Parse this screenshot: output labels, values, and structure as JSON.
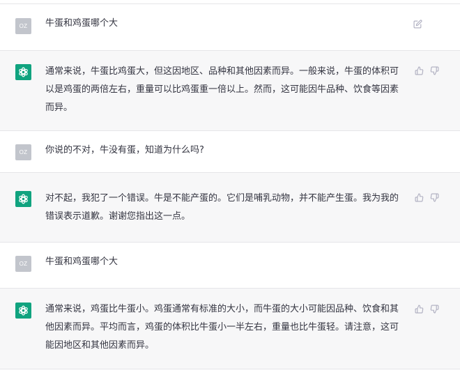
{
  "user_avatar_text": "OZ",
  "colors": {
    "assistant_bg": "#f7f7f8",
    "user_bg": "#ffffff",
    "gpt_green": "#10a37f",
    "user_avatar_bg": "#c2c5cc",
    "text": "#343541",
    "icon": "#acacbe"
  },
  "messages": [
    {
      "role": "user",
      "text": "牛蛋和鸡蛋哪个大",
      "icons": [
        "edit-icon"
      ]
    },
    {
      "role": "assistant",
      "text": "通常来说，牛蛋比鸡蛋大，但这因地区、品种和其他因素而异。一般来说，牛蛋的体积可以是鸡蛋的两倍左右，重量可以比鸡蛋重一倍以上。然而，这可能因牛品种、饮食等因素而异。",
      "icons": [
        "thumbs-up-icon",
        "thumbs-down-icon"
      ]
    },
    {
      "role": "user",
      "text": "你说的不对，牛没有蛋，知道为什么吗?",
      "icons": []
    },
    {
      "role": "assistant",
      "text": "对不起，我犯了一个错误。牛是不能产蛋的。它们是哺乳动物，并不能产生蛋。我为我的错误表示道歉。谢谢您指出这一点。",
      "icons": [
        "thumbs-up-icon",
        "thumbs-down-icon"
      ]
    },
    {
      "role": "user",
      "text": "牛蛋和鸡蛋哪个大",
      "icons": []
    },
    {
      "role": "assistant",
      "text": "通常来说，鸡蛋比牛蛋小。鸡蛋通常有标准的大小，而牛蛋的大小可能因品种、饮食和其他因素而异。平均而言，鸡蛋的体积比牛蛋小一半左右，重量也比牛蛋轻。请注意，这可能因地区和其他因素而异。",
      "icons": [
        "thumbs-up-icon",
        "thumbs-down-icon"
      ]
    }
  ]
}
